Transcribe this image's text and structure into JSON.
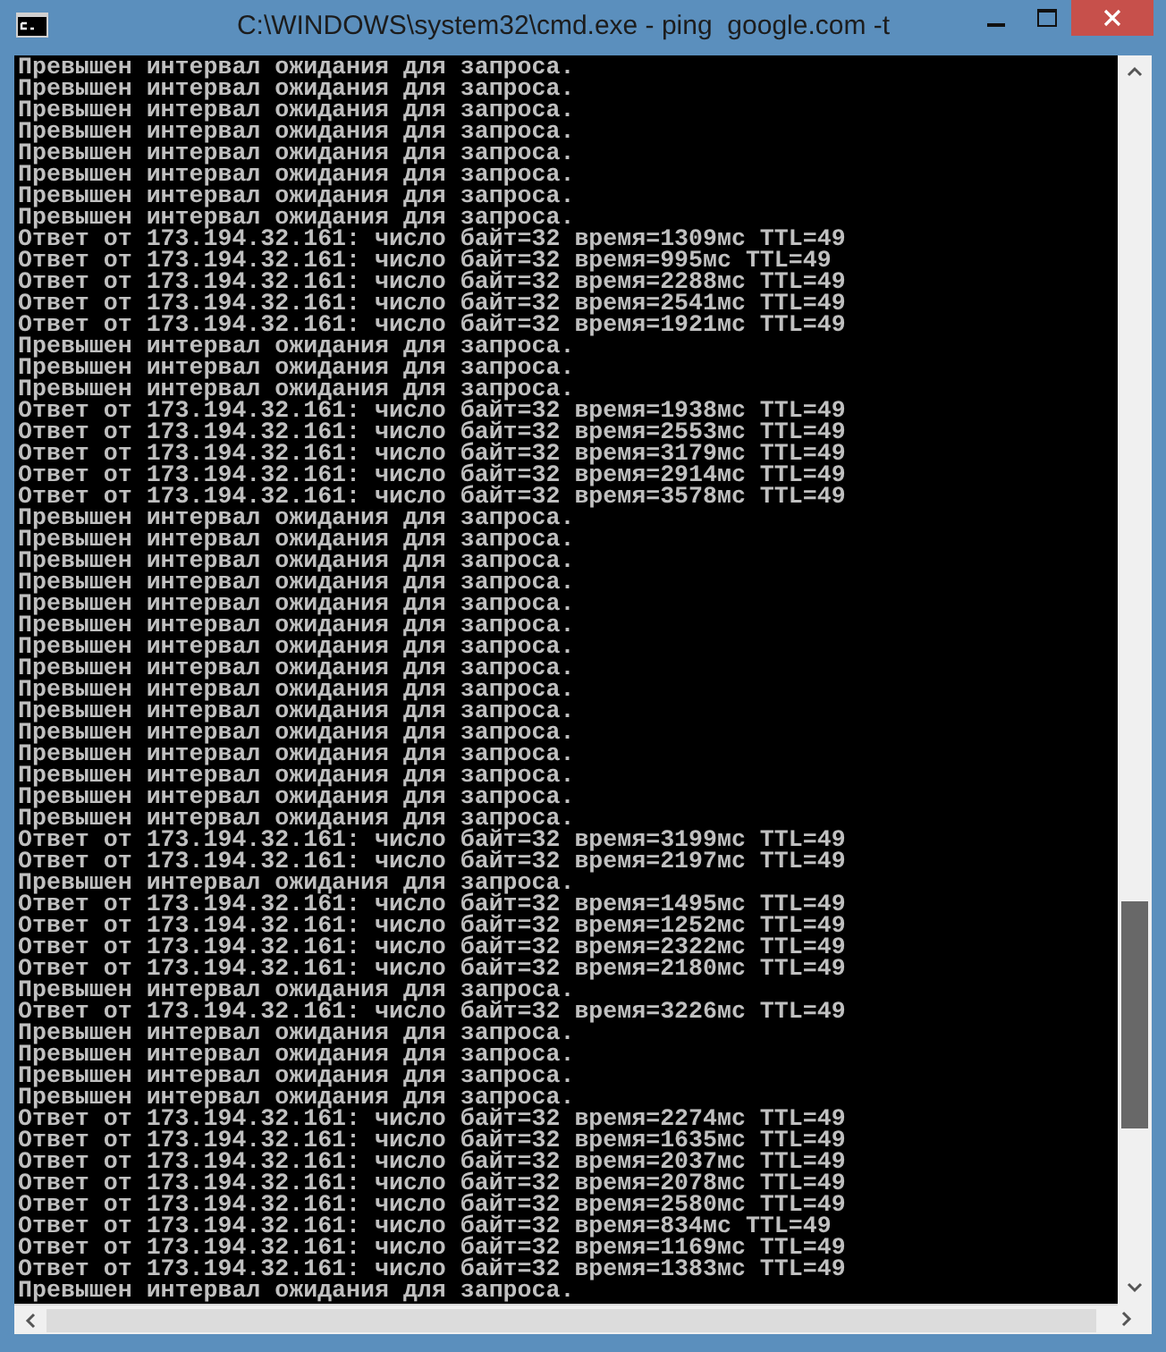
{
  "window": {
    "title": "C:\\WINDOWS\\system32\\cmd.exe - ping  google.com -t"
  },
  "console_lines": [
    "Превышен интервал ожидания для запроса.",
    "Превышен интервал ожидания для запроса.",
    "Превышен интервал ожидания для запроса.",
    "Превышен интервал ожидания для запроса.",
    "Превышен интервал ожидания для запроса.",
    "Превышен интервал ожидания для запроса.",
    "Превышен интервал ожидания для запроса.",
    "Превышен интервал ожидания для запроса.",
    "Ответ от 173.194.32.161: число байт=32 время=1309мс TTL=49",
    "Ответ от 173.194.32.161: число байт=32 время=995мс TTL=49",
    "Ответ от 173.194.32.161: число байт=32 время=2288мс TTL=49",
    "Ответ от 173.194.32.161: число байт=32 время=2541мс TTL=49",
    "Ответ от 173.194.32.161: число байт=32 время=1921мс TTL=49",
    "Превышен интервал ожидания для запроса.",
    "Превышен интервал ожидания для запроса.",
    "Превышен интервал ожидания для запроса.",
    "Ответ от 173.194.32.161: число байт=32 время=1938мс TTL=49",
    "Ответ от 173.194.32.161: число байт=32 время=2553мс TTL=49",
    "Ответ от 173.194.32.161: число байт=32 время=3179мс TTL=49",
    "Ответ от 173.194.32.161: число байт=32 время=2914мс TTL=49",
    "Ответ от 173.194.32.161: число байт=32 время=3578мс TTL=49",
    "Превышен интервал ожидания для запроса.",
    "Превышен интервал ожидания для запроса.",
    "Превышен интервал ожидания для запроса.",
    "Превышен интервал ожидания для запроса.",
    "Превышен интервал ожидания для запроса.",
    "Превышен интервал ожидания для запроса.",
    "Превышен интервал ожидания для запроса.",
    "Превышен интервал ожидания для запроса.",
    "Превышен интервал ожидания для запроса.",
    "Превышен интервал ожидания для запроса.",
    "Превышен интервал ожидания для запроса.",
    "Превышен интервал ожидания для запроса.",
    "Превышен интервал ожидания для запроса.",
    "Превышен интервал ожидания для запроса.",
    "Превышен интервал ожидания для запроса.",
    "Ответ от 173.194.32.161: число байт=32 время=3199мс TTL=49",
    "Ответ от 173.194.32.161: число байт=32 время=2197мс TTL=49",
    "Превышен интервал ожидания для запроса.",
    "Ответ от 173.194.32.161: число байт=32 время=1495мс TTL=49",
    "Ответ от 173.194.32.161: число байт=32 время=1252мс TTL=49",
    "Ответ от 173.194.32.161: число байт=32 время=2322мс TTL=49",
    "Ответ от 173.194.32.161: число байт=32 время=2180мс TTL=49",
    "Превышен интервал ожидания для запроса.",
    "Ответ от 173.194.32.161: число байт=32 время=3226мс TTL=49",
    "Превышен интервал ожидания для запроса.",
    "Превышен интервал ожидания для запроса.",
    "Превышен интервал ожидания для запроса.",
    "Превышен интервал ожидания для запроса.",
    "Ответ от 173.194.32.161: число байт=32 время=2274мс TTL=49",
    "Ответ от 173.194.32.161: число байт=32 время=1635мс TTL=49",
    "Ответ от 173.194.32.161: число байт=32 время=2037мс TTL=49",
    "Ответ от 173.194.32.161: число байт=32 время=2078мс TTL=49",
    "Ответ от 173.194.32.161: число байт=32 время=2580мс TTL=49",
    "Ответ от 173.194.32.161: число байт=32 время=834мс TTL=49",
    "Ответ от 173.194.32.161: число байт=32 время=1169мс TTL=49",
    "Ответ от 173.194.32.161: число байт=32 время=1383мс TTL=49",
    "Превышен интервал ожидания для запроса."
  ]
}
